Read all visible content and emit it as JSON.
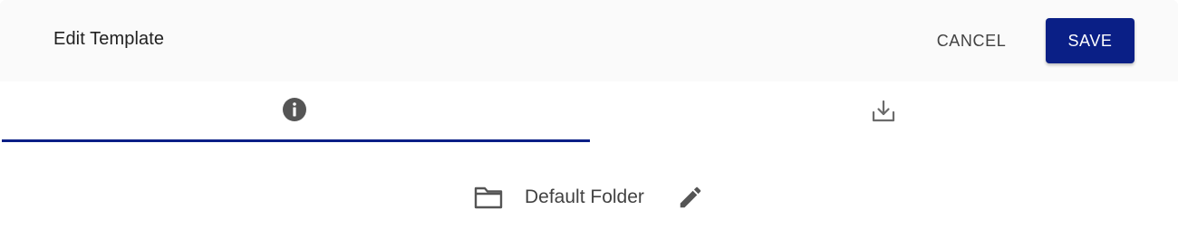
{
  "header": {
    "title": "Edit Template",
    "cancel_label": "CANCEL",
    "save_label": "SAVE"
  },
  "tabs": [
    {
      "icon": "info-icon",
      "active": true
    },
    {
      "icon": "download-icon",
      "active": false
    }
  ],
  "folder": {
    "icon": "folder-icon",
    "name": "Default Folder",
    "edit_icon": "pencil-icon"
  },
  "colors": {
    "accent": "#0a1f86",
    "header_bg": "#fafafa",
    "text_primary": "#212121",
    "icon": "#555555"
  }
}
